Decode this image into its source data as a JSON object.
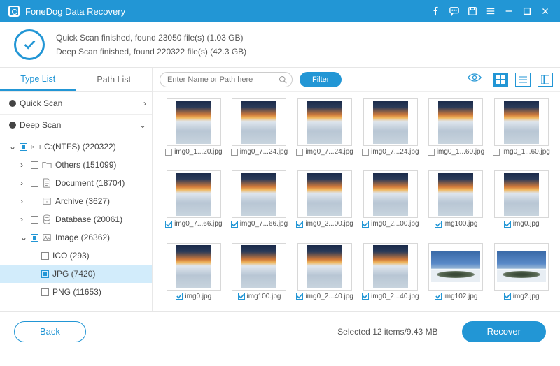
{
  "titlebar": {
    "title": "FoneDog Data Recovery"
  },
  "status": {
    "line1": "Quick Scan finished, found 23050 file(s) (1.03 GB)",
    "line2": "Deep Scan finished, found 220322 file(s) (42.3 GB)"
  },
  "tabs": {
    "type_list": "Type List",
    "path_list": "Path List"
  },
  "tree": {
    "quick_scan": "Quick Scan",
    "deep_scan": "Deep Scan",
    "drive": "C:(NTFS) (220322)",
    "others": "Others (151099)",
    "document": "Document (18704)",
    "archive": "Archive (3627)",
    "database": "Database (20061)",
    "image": "Image (26362)",
    "ico": "ICO (293)",
    "jpg": "JPG (7420)",
    "png": "PNG (11653)"
  },
  "toolbar": {
    "search_placeholder": "Enter Name or Path here",
    "filter": "Filter"
  },
  "grid": [
    {
      "name": "img0_1...20.jpg",
      "checked": false,
      "variant": "sky"
    },
    {
      "name": "img0_7...24.jpg",
      "checked": false,
      "variant": "sky"
    },
    {
      "name": "img0_7...24.jpg",
      "checked": false,
      "variant": "sky"
    },
    {
      "name": "img0_7...24.jpg",
      "checked": false,
      "variant": "sky"
    },
    {
      "name": "img0_1...60.jpg",
      "checked": false,
      "variant": "sky"
    },
    {
      "name": "img0_1...60.jpg",
      "checked": false,
      "variant": "sky"
    },
    {
      "name": "img0_7...66.jpg",
      "checked": true,
      "variant": "sky"
    },
    {
      "name": "img0_7...66.jpg",
      "checked": true,
      "variant": "sky"
    },
    {
      "name": "img0_2...00.jpg",
      "checked": true,
      "variant": "sky"
    },
    {
      "name": "img0_2...00.jpg",
      "checked": true,
      "variant": "sky"
    },
    {
      "name": "img100.jpg",
      "checked": true,
      "variant": "sky"
    },
    {
      "name": "img0.jpg",
      "checked": true,
      "variant": "sky"
    },
    {
      "name": "img0.jpg",
      "checked": true,
      "variant": "sky"
    },
    {
      "name": "img100.jpg",
      "checked": true,
      "variant": "sky"
    },
    {
      "name": "img0_2...40.jpg",
      "checked": true,
      "variant": "sky"
    },
    {
      "name": "img0_2...40.jpg",
      "checked": true,
      "variant": "sky"
    },
    {
      "name": "img102.jpg",
      "checked": true,
      "variant": "wide"
    },
    {
      "name": "img2.jpg",
      "checked": true,
      "variant": "wide"
    }
  ],
  "footer": {
    "back": "Back",
    "selected": "Selected 12 items/9.43 MB",
    "recover": "Recover"
  }
}
